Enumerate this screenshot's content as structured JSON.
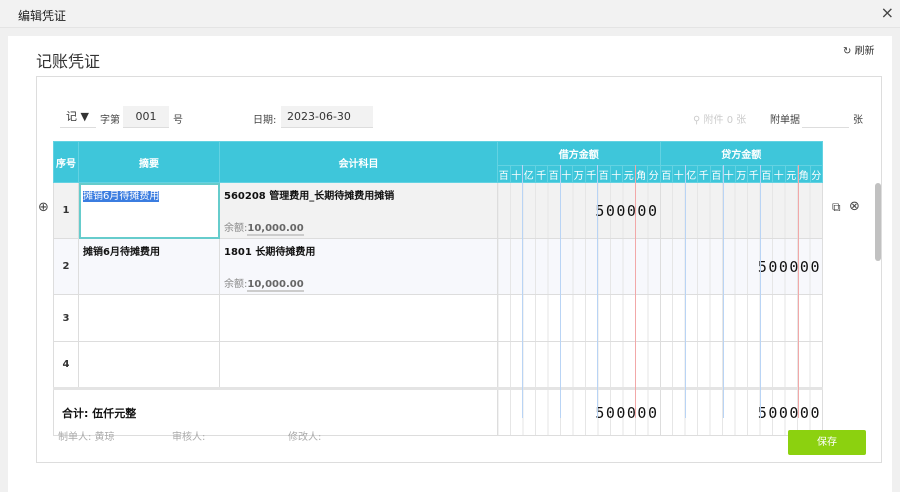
{
  "dialog": {
    "title": "编辑凭证",
    "close": "×"
  },
  "page": {
    "title": "记账凭证",
    "refresh": "刷新"
  },
  "form": {
    "voucher_type": "记",
    "zi_label": "字第",
    "number": "001",
    "hao_label": "号",
    "date_label": "日期:",
    "date": "2023-06-30",
    "attachment": "附件 0 张",
    "fujian_label": "附单据",
    "fujian_value": "",
    "zhang": "张"
  },
  "table": {
    "headers": {
      "seq": "序号",
      "summary": "摘要",
      "account": "会计科目",
      "debit": "借方金额",
      "credit": "贷方金额"
    },
    "digits": [
      "百",
      "十",
      "亿",
      "千",
      "百",
      "十",
      "万",
      "千",
      "百",
      "十",
      "元",
      "角",
      "分"
    ],
    "rows": [
      {
        "seq": "1",
        "summary": "摊销6月待摊费用",
        "account": "560208 管理费用_长期待摊费用摊销",
        "balance_label": "余额:",
        "balance": "10,000.00",
        "debit": "500000",
        "credit": ""
      },
      {
        "seq": "2",
        "summary": "摊销6月待摊费用",
        "account": "1801 长期待摊费用",
        "balance_label": "余额:",
        "balance": "10,000.00",
        "debit": "",
        "credit": "500000"
      },
      {
        "seq": "3",
        "summary": "",
        "account": "",
        "debit": "",
        "credit": ""
      },
      {
        "seq": "4",
        "summary": "",
        "account": "",
        "debit": "",
        "credit": ""
      }
    ],
    "total": {
      "label": "合计:",
      "words": "伍仟元整",
      "debit": "500000",
      "credit": "500000"
    }
  },
  "footer": {
    "maker": "制单人: 黄琼",
    "reviewer": "审核人:",
    "modifier": "修改人:",
    "save": "保存"
  },
  "colors": {
    "header": "#3ec6da",
    "save": "#8cd10f"
  }
}
